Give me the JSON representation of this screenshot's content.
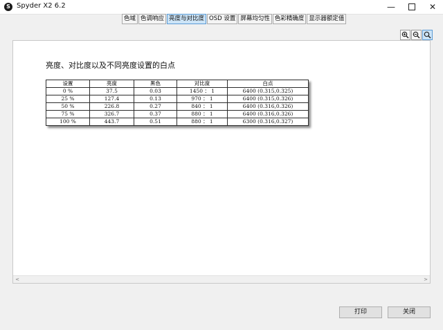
{
  "window": {
    "title": "Spyder X2 6.2",
    "icon_letter": "S",
    "minimize_glyph": "—",
    "close_glyph": "✕"
  },
  "tabs": [
    {
      "label": "色域",
      "active": false
    },
    {
      "label": "色调响应",
      "active": false
    },
    {
      "label": "亮度与对比度",
      "active": true
    },
    {
      "label": "OSD 设置",
      "active": false
    },
    {
      "label": "屏幕均匀性",
      "active": false
    },
    {
      "label": "色彩精确度",
      "active": false
    },
    {
      "label": "显示器额定值",
      "active": false
    }
  ],
  "zoom": {
    "zoom_in_icon": "zoom-in-icon",
    "zoom_out_icon": "zoom-out-icon",
    "zoom_fit_icon": "zoom-fit-icon"
  },
  "report": {
    "heading": "亮度、对比度以及不同亮度设置的白点",
    "columns": [
      "设置",
      "亮度",
      "黑色",
      "对比度",
      "白点"
    ],
    "rows": [
      [
        "0 %",
        "37.5",
        "0.03",
        "1450 ： 1",
        "6400 (0.315,0.325)"
      ],
      [
        "25 %",
        "127.4",
        "0.13",
        "970 ： 1",
        "6400 (0.315,0.326)"
      ],
      [
        "50 %",
        "226.8",
        "0.27",
        "840 ： 1",
        "6400 (0.316,0.326)"
      ],
      [
        "75 %",
        "326.7",
        "0.37",
        "880 ： 1",
        "6400 (0.316,0.326)"
      ],
      [
        "100 %",
        "443.7",
        "0.51",
        "880 ： 1",
        "6300 (0.316,0.327)"
      ]
    ]
  },
  "scrollbar": {
    "left_arrow": "<",
    "right_arrow": ">"
  },
  "footer": {
    "print_label": "打印",
    "close_label": "关闭"
  }
}
